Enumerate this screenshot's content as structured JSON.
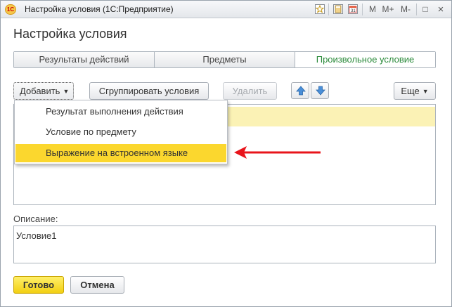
{
  "window": {
    "title": "Настройка условия  (1С:Предприятие)",
    "app_icon": "1С",
    "toolbar": {
      "icons": [
        "favorite-icon",
        "calculator-icon",
        "calendar-icon"
      ],
      "m_label": "M",
      "m_plus_label": "M+",
      "m_minus_label": "M-",
      "restore_label": "□",
      "close_label": "×"
    }
  },
  "form": {
    "heading": "Настройка условия"
  },
  "tabs": [
    {
      "label": "Результаты действий",
      "active": false
    },
    {
      "label": "Предметы",
      "active": false
    },
    {
      "label": "Произвольное условие",
      "active": true
    }
  ],
  "command_bar": {
    "add_label": "Добавить",
    "group_label": "Сгруппировать условия",
    "delete_label": "Удалить",
    "more_label": "Еще"
  },
  "dropdown": {
    "items": [
      {
        "label": "Результат выполнения действия",
        "selected": false
      },
      {
        "label": "Условие по предмету",
        "selected": false
      },
      {
        "label": "Выражение на встроенном языке",
        "selected": true
      }
    ]
  },
  "description": {
    "label": "Описание:",
    "value": "Условие1"
  },
  "footer": {
    "ok_label": "Готово",
    "cancel_label": "Отмена"
  },
  "colors": {
    "accent_yellow": "#fbd72e",
    "highlight_row": "#fbf2b5",
    "active_tab_text": "#2a8a3a",
    "annotation_arrow": "#e8141b"
  }
}
